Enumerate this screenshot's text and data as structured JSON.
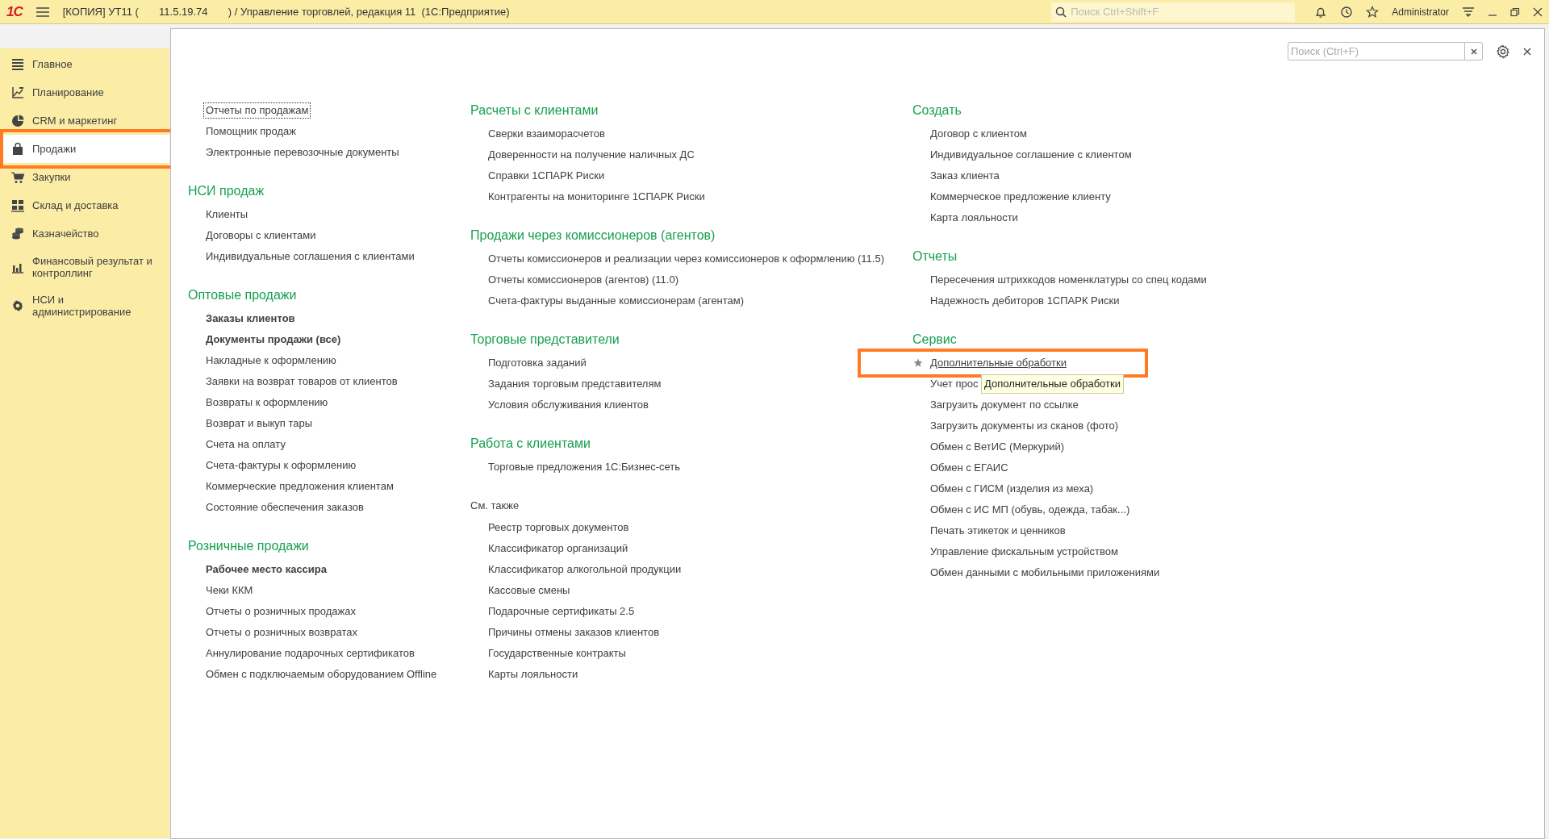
{
  "title_bar": {
    "logo": "1С",
    "title": "[КОПИЯ] УТ11 (       11.5.19.74       ) / Управление торговлей, редакция 11  (1С:Предприятие)",
    "search": {
      "placeholder": "Поиск Ctrl+Shift+F"
    },
    "user": "Administrator"
  },
  "sidebar": {
    "items": [
      {
        "label": "Главное",
        "selected": false,
        "highlighted": false
      },
      {
        "label": "Планирование",
        "selected": false,
        "highlighted": false
      },
      {
        "label": "CRM и маркетинг",
        "selected": false,
        "highlighted": false
      },
      {
        "label": "Продажи",
        "selected": true,
        "highlighted": true
      },
      {
        "label": "Закупки",
        "selected": false,
        "highlighted": false
      },
      {
        "label": "Склад и доставка",
        "selected": false,
        "highlighted": false
      },
      {
        "label": "Казначейство",
        "selected": false,
        "highlighted": false
      },
      {
        "label": "Финансовый результат и контроллинг",
        "selected": false,
        "highlighted": false
      },
      {
        "label": "НСИ и администрирование",
        "selected": false,
        "highlighted": false
      }
    ]
  },
  "panel": {
    "search": {
      "placeholder": "Поиск (Ctrl+F)"
    },
    "columns": [
      {
        "groups": [
          {
            "kind": "plain",
            "items": [
              {
                "text": "Отчеты по продажам",
                "bold": false,
                "focused": true,
                "hovered": false,
                "highlighted": false
              },
              {
                "text": "Помощник продаж",
                "bold": false,
                "focused": false,
                "hovered": false,
                "highlighted": false
              },
              {
                "text": "Электронные перевозочные документы",
                "bold": false,
                "focused": false,
                "hovered": false,
                "highlighted": false
              }
            ]
          },
          {
            "kind": "heading",
            "title": "НСИ продаж",
            "items": [
              {
                "text": "Клиенты",
                "bold": false,
                "focused": false,
                "hovered": false,
                "highlighted": false
              },
              {
                "text": "Договоры с клиентами",
                "bold": false,
                "focused": false,
                "hovered": false,
                "highlighted": false
              },
              {
                "text": "Индивидуальные соглашения с клиентами",
                "bold": false,
                "focused": false,
                "hovered": false,
                "highlighted": false
              }
            ]
          },
          {
            "kind": "heading",
            "title": "Оптовые продажи",
            "items": [
              {
                "text": "Заказы клиентов",
                "bold": true,
                "focused": false,
                "hovered": false,
                "highlighted": false
              },
              {
                "text": "Документы продажи (все)",
                "bold": true,
                "focused": false,
                "hovered": false,
                "highlighted": false
              },
              {
                "text": "Накладные к оформлению",
                "bold": false,
                "focused": false,
                "hovered": false,
                "highlighted": false
              },
              {
                "text": "Заявки на возврат товаров от клиентов",
                "bold": false,
                "focused": false,
                "hovered": false,
                "highlighted": false
              },
              {
                "text": "Возвраты к оформлению",
                "bold": false,
                "focused": false,
                "hovered": false,
                "highlighted": false
              },
              {
                "text": "Возврат и выкуп тары",
                "bold": false,
                "focused": false,
                "hovered": false,
                "highlighted": false
              },
              {
                "text": "Счета на оплату",
                "bold": false,
                "focused": false,
                "hovered": false,
                "highlighted": false
              },
              {
                "text": "Счета-фактуры к оформлению",
                "bold": false,
                "focused": false,
                "hovered": false,
                "highlighted": false
              },
              {
                "text": "Коммерческие предложения клиентам",
                "bold": false,
                "focused": false,
                "hovered": false,
                "highlighted": false
              },
              {
                "text": "Состояние обеспечения заказов",
                "bold": false,
                "focused": false,
                "hovered": false,
                "highlighted": false
              }
            ]
          },
          {
            "kind": "heading",
            "title": "Розничные продажи",
            "items": [
              {
                "text": "Рабочее место кассира",
                "bold": true,
                "focused": false,
                "hovered": false,
                "highlighted": false
              },
              {
                "text": "Чеки ККМ",
                "bold": false,
                "focused": false,
                "hovered": false,
                "highlighted": false
              },
              {
                "text": "Отчеты о розничных продажах",
                "bold": false,
                "focused": false,
                "hovered": false,
                "highlighted": false
              },
              {
                "text": "Отчеты о розничных возвратах",
                "bold": false,
                "focused": false,
                "hovered": false,
                "highlighted": false
              },
              {
                "text": "Аннулирование подарочных сертификатов",
                "bold": false,
                "focused": false,
                "hovered": false,
                "highlighted": false
              },
              {
                "text": "Обмен с подключаемым оборудованием Offline",
                "bold": false,
                "focused": false,
                "hovered": false,
                "highlighted": false
              }
            ]
          }
        ]
      },
      {
        "groups": [
          {
            "kind": "heading",
            "title": "Расчеты с клиентами",
            "items": [
              {
                "text": "Сверки взаиморасчетов",
                "bold": false,
                "focused": false,
                "hovered": false,
                "highlighted": false
              },
              {
                "text": "Доверенности на получение наличных ДС",
                "bold": false,
                "focused": false,
                "hovered": false,
                "highlighted": false
              },
              {
                "text": "Справки 1СПАРК Риски",
                "bold": false,
                "focused": false,
                "hovered": false,
                "highlighted": false
              },
              {
                "text": "Контрагенты на мониторинге 1СПАРК Риски",
                "bold": false,
                "focused": false,
                "hovered": false,
                "highlighted": false
              }
            ]
          },
          {
            "kind": "heading",
            "title": "Продажи через комиссионеров (агентов)",
            "items": [
              {
                "text": "Отчеты комиссионеров и реализации через комиссионеров к оформлению (11.5)",
                "bold": false,
                "focused": false,
                "hovered": false,
                "highlighted": false
              },
              {
                "text": "Отчеты комиссионеров (агентов) (11.0)",
                "bold": false,
                "focused": false,
                "hovered": false,
                "highlighted": false
              },
              {
                "text": "Счета-фактуры выданные комиссионерам (агентам)",
                "bold": false,
                "focused": false,
                "hovered": false,
                "highlighted": false
              }
            ]
          },
          {
            "kind": "heading",
            "title": "Торговые представители",
            "items": [
              {
                "text": "Подготовка заданий",
                "bold": false,
                "focused": false,
                "hovered": false,
                "highlighted": false
              },
              {
                "text": "Задания торговым представителям",
                "bold": false,
                "focused": false,
                "hovered": false,
                "highlighted": false
              },
              {
                "text": "Условия обслуживания клиентов",
                "bold": false,
                "focused": false,
                "hovered": false,
                "highlighted": false
              }
            ]
          },
          {
            "kind": "heading",
            "title": "Работа с клиентами",
            "items": [
              {
                "text": "Торговые предложения 1С:Бизнес-сеть",
                "bold": false,
                "focused": false,
                "hovered": false,
                "highlighted": false
              }
            ]
          },
          {
            "kind": "see_also",
            "title": "См. также",
            "items": [
              {
                "text": "Реестр торговых документов",
                "bold": false,
                "focused": false,
                "hovered": false,
                "highlighted": false
              },
              {
                "text": "Классификатор организаций",
                "bold": false,
                "focused": false,
                "hovered": false,
                "highlighted": false
              },
              {
                "text": "Классификатор алкогольной продукции",
                "bold": false,
                "focused": false,
                "hovered": false,
                "highlighted": false
              },
              {
                "text": "Кассовые смены",
                "bold": false,
                "focused": false,
                "hovered": false,
                "highlighted": false
              },
              {
                "text": "Подарочные сертификаты 2.5",
                "bold": false,
                "focused": false,
                "hovered": false,
                "highlighted": false
              },
              {
                "text": "Причины отмены заказов клиентов",
                "bold": false,
                "focused": false,
                "hovered": false,
                "highlighted": false
              },
              {
                "text": "Государственные контракты",
                "bold": false,
                "focused": false,
                "hovered": false,
                "highlighted": false
              },
              {
                "text": "Карты лояльности",
                "bold": false,
                "focused": false,
                "hovered": false,
                "highlighted": false
              }
            ]
          }
        ]
      },
      {
        "groups": [
          {
            "kind": "heading",
            "title": "Создать",
            "items": [
              {
                "text": "Договор с клиентом",
                "bold": false,
                "focused": false,
                "hovered": false,
                "highlighted": false
              },
              {
                "text": "Индивидуальное соглашение с клиентом",
                "bold": false,
                "focused": false,
                "hovered": false,
                "highlighted": false
              },
              {
                "text": "Заказ клиента",
                "bold": false,
                "focused": false,
                "hovered": false,
                "highlighted": false
              },
              {
                "text": "Коммерческое предложение клиенту",
                "bold": false,
                "focused": false,
                "hovered": false,
                "highlighted": false
              },
              {
                "text": "Карта лояльности",
                "bold": false,
                "focused": false,
                "hovered": false,
                "highlighted": false
              }
            ]
          },
          {
            "kind": "heading",
            "title": "Отчеты",
            "items": [
              {
                "text": "Пересечения штрихкодов номенклатуры со спец кодами",
                "bold": false,
                "focused": false,
                "hovered": false,
                "highlighted": false
              },
              {
                "text": "Надежность дебиторов 1СПАРК Риски",
                "bold": false,
                "focused": false,
                "hovered": false,
                "highlighted": false
              }
            ]
          },
          {
            "kind": "heading",
            "title": "Сервис",
            "items": [
              {
                "text": "Дополнительные обработки",
                "bold": false,
                "focused": false,
                "hovered": true,
                "highlighted": true
              },
              {
                "text": "Учет прос",
                "bold": false,
                "focused": false,
                "hovered": false,
                "highlighted": false,
                "tooltip": "Дополнительные обработки"
              },
              {
                "text": "Загрузить документ по ссылке",
                "bold": false,
                "focused": false,
                "hovered": false,
                "highlighted": false
              },
              {
                "text": "Загрузить документы из сканов (фото)",
                "bold": false,
                "focused": false,
                "hovered": false,
                "highlighted": false
              },
              {
                "text": "Обмен с ВетИС (Меркурий)",
                "bold": false,
                "focused": false,
                "hovered": false,
                "highlighted": false
              },
              {
                "text": "Обмен с ЕГАИС",
                "bold": false,
                "focused": false,
                "hovered": false,
                "highlighted": false
              },
              {
                "text": "Обмен с ГИСМ (изделия из меха)",
                "bold": false,
                "focused": false,
                "hovered": false,
                "highlighted": false
              },
              {
                "text": "Обмен с ИС МП (обувь, одежда, табак...)",
                "bold": false,
                "focused": false,
                "hovered": false,
                "highlighted": false
              },
              {
                "text": "Печать этикеток и ценников",
                "bold": false,
                "focused": false,
                "hovered": false,
                "highlighted": false
              },
              {
                "text": "Управление фискальным устройством",
                "bold": false,
                "focused": false,
                "hovered": false,
                "highlighted": false
              },
              {
                "text": "Обмен данными с мобильными приложениями",
                "bold": false,
                "focused": false,
                "hovered": false,
                "highlighted": false
              }
            ]
          }
        ]
      }
    ]
  }
}
